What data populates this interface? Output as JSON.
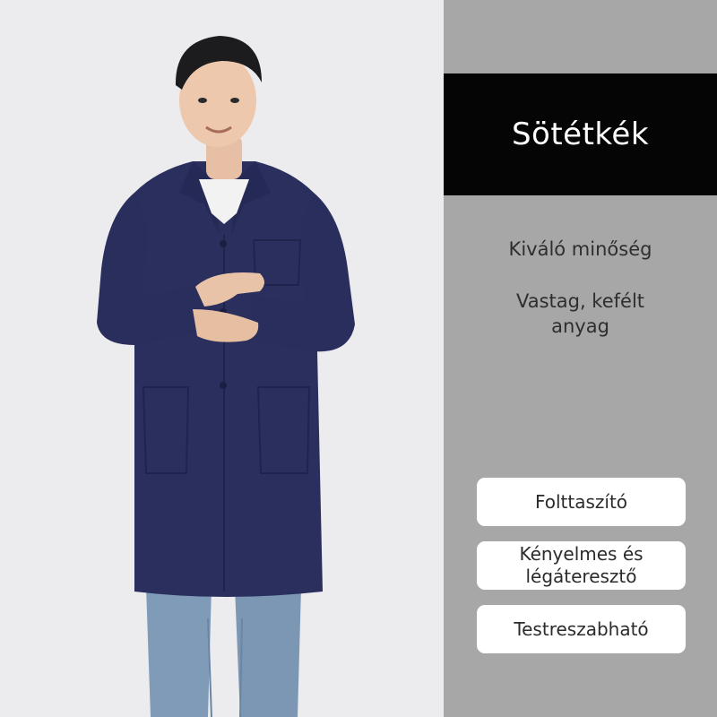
{
  "colors": {
    "coat": "#2b2f5e",
    "background_left": "#ececee",
    "background_right": "#a7a7a8",
    "banner": "#050505",
    "badge": "#ffffff"
  },
  "photo": {
    "subject": "man-in-navy-lab-coat-and-jeans"
  },
  "info": {
    "color_name": "Sötétkék",
    "quality": "Kiváló minőség",
    "material_line1": "Vastag, kefélt",
    "material_line2": "anyag",
    "badges": [
      {
        "label": "Folttaszító"
      },
      {
        "label_line1": "Kényelmes és",
        "label_line2": "légáteresztő"
      },
      {
        "label": "Testreszabható"
      }
    ]
  }
}
